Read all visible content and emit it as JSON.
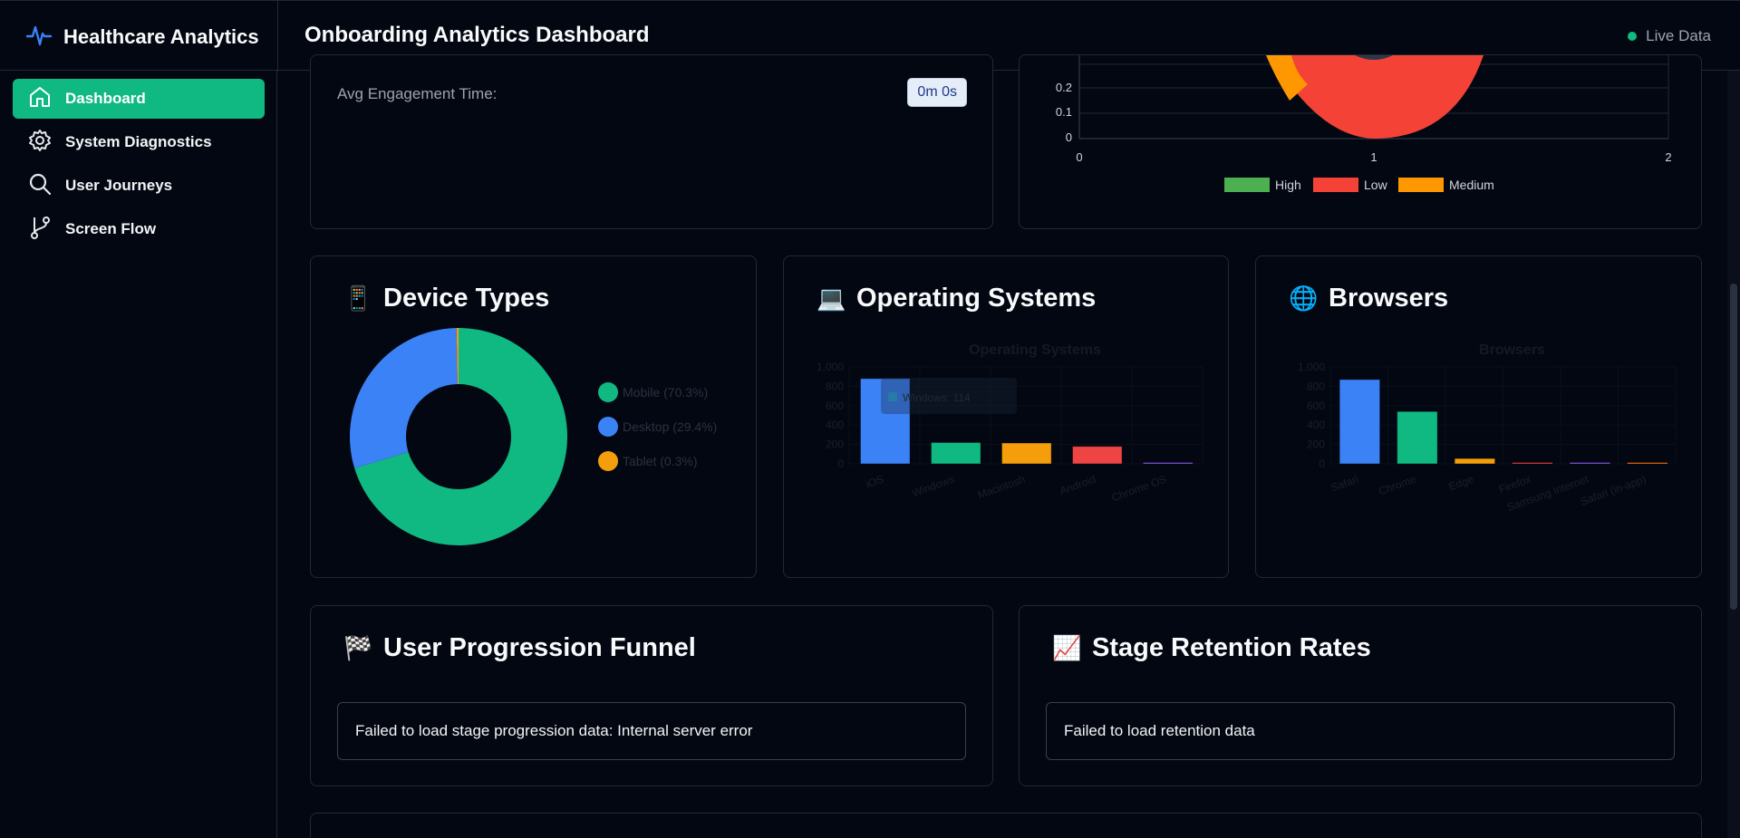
{
  "app": {
    "brand": "Healthcare Analytics",
    "page_title": "Onboarding Analytics Dashboard",
    "live_label": "Live Data"
  },
  "nav": [
    {
      "label": "Dashboard",
      "icon": "home-icon",
      "active": true
    },
    {
      "label": "System Diagnostics",
      "icon": "gear-icon",
      "active": false
    },
    {
      "label": "User Journeys",
      "icon": "search-icon",
      "active": false
    },
    {
      "label": "Screen Flow",
      "icon": "git-branch-icon",
      "active": false
    }
  ],
  "engagement": {
    "label": "Avg Engagement Time:",
    "value": "0m 0s"
  },
  "priority_chart": {
    "legend": [
      "High",
      "Low",
      "Medium"
    ],
    "colors": [
      "#4caf50",
      "#f44336",
      "#ff9800"
    ],
    "y_ticks": [
      "0.2",
      "0.1",
      "0"
    ],
    "x_ticks": [
      "0",
      "1",
      "2"
    ]
  },
  "device_types": {
    "title": "Device Types",
    "emoji": "📱",
    "legend": [
      "Mobile (70.3%)",
      "Desktop (29.4%)",
      "Tablet (0.3%)"
    ]
  },
  "operating_systems": {
    "title": "Operating Systems",
    "emoji": "💻",
    "chart_title": "Operating Systems",
    "tooltip": "Windows: 114"
  },
  "browsers": {
    "title": "Browsers",
    "emoji": "🌐",
    "chart_title": "Browsers"
  },
  "funnel": {
    "title": "User Progression Funnel",
    "emoji": "🏁",
    "error": "Failed to load stage progression data: Internal server error"
  },
  "retention": {
    "title": "Stage Retention Rates",
    "emoji": "📈",
    "error": "Failed to load retention data"
  },
  "chart_data": [
    {
      "type": "pie",
      "title": "Device Types",
      "categories": [
        "Mobile",
        "Desktop",
        "Tablet"
      ],
      "values": [
        70.3,
        29.4,
        0.3
      ],
      "colors": [
        "#10b981",
        "#3b82f6",
        "#f59e0b"
      ]
    },
    {
      "type": "bar",
      "title": "Operating Systems",
      "categories": [
        "iOS",
        "Windows",
        "Macintosh",
        "Android",
        "Chrome OS"
      ],
      "values": [
        880,
        220,
        215,
        180,
        10
      ],
      "colors": [
        "#3b82f6",
        "#10b981",
        "#f59e0b",
        "#ef4444",
        "#8b5cf6"
      ],
      "y_ticks": [
        "1,000",
        "800",
        "600",
        "400",
        "200",
        "0"
      ],
      "ylim": [
        0,
        1000
      ]
    },
    {
      "type": "bar",
      "title": "Browsers",
      "categories": [
        "Safari",
        "Chrome",
        "Edge",
        "Firefox",
        "Samsung Internet",
        "Safari (in-app)"
      ],
      "values": [
        870,
        540,
        55,
        8,
        5,
        4
      ],
      "colors": [
        "#3b82f6",
        "#10b981",
        "#f59e0b",
        "#ef4444",
        "#8b5cf6",
        "#f97316"
      ],
      "y_ticks": [
        "1,000",
        "800",
        "600",
        "400",
        "200",
        "0"
      ],
      "ylim": [
        0,
        1000
      ]
    }
  ]
}
